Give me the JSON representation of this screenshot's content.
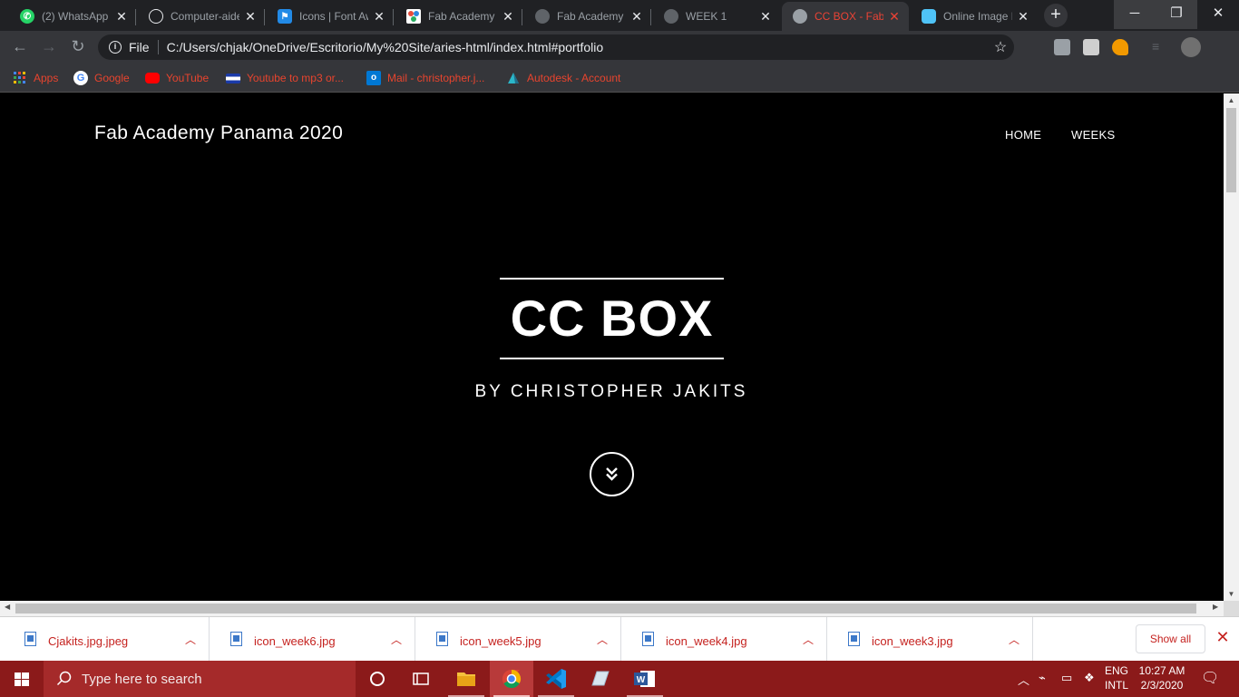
{
  "browser": {
    "tabs": [
      {
        "title": "(2) WhatsApp",
        "favicon": "whatsapp-icon",
        "color": "#25d366"
      },
      {
        "title": "Computer-aided",
        "favicon": "github-icon",
        "color": "#e8eaed"
      },
      {
        "title": "Icons | Font Awesome",
        "favicon": "font-awesome-icon",
        "color": "#228ae6"
      },
      {
        "title": "Fab Academy",
        "favicon": "fab-academy-icon",
        "color": "#e74c3c"
      },
      {
        "title": "Fab Academy",
        "favicon": "globe-icon",
        "color": "#5f6368"
      },
      {
        "title": "WEEK 1",
        "favicon": "globe-icon",
        "color": "#5f6368"
      },
      {
        "title": "CC BOX - Fab Academy",
        "favicon": "globe-icon",
        "color": "#9aa0a6",
        "active": true
      },
      {
        "title": "Online Image Editor",
        "favicon": "cloud-icon",
        "color": "#4fc3f7"
      }
    ],
    "omnibox": {
      "scheme": "File",
      "url": "C:/Users/chjak/OneDrive/Escritorio/My%20Site/aries-html/index.html#portfolio"
    },
    "bookmarks": [
      {
        "label": "Apps",
        "icon": "apps-grid-icon"
      },
      {
        "label": "Google",
        "icon": "google-icon"
      },
      {
        "label": "YouTube",
        "icon": "youtube-icon"
      },
      {
        "label": "Youtube to mp3 or...",
        "icon": "flag-icon"
      },
      {
        "label": "Mail - christopher.j...",
        "icon": "outlook-icon"
      },
      {
        "label": "Autodesk - Account",
        "icon": "autodesk-icon"
      }
    ]
  },
  "page": {
    "brand": "Fab Academy Panama 2020",
    "nav": [
      "HOME",
      "WEEKS"
    ],
    "hero_title": "CC BOX",
    "hero_subtitle": "BY CHRISTOPHER JAKITS"
  },
  "downloads": {
    "items": [
      "Cjakits.jpg.jpeg",
      "icon_week6.jpg",
      "icon_week5.jpg",
      "icon_week4.jpg",
      "icon_week3.jpg"
    ],
    "show_all": "Show all"
  },
  "taskbar": {
    "search_placeholder": "Type here to search",
    "lang_top": "ENG",
    "lang_bottom": "INTL",
    "time": "10:27 AM",
    "date": "2/3/2020"
  },
  "colors": {
    "taskbar": "#8b1a1a",
    "download_text": "#c5221f",
    "active_tab_text": "#ea4335"
  }
}
